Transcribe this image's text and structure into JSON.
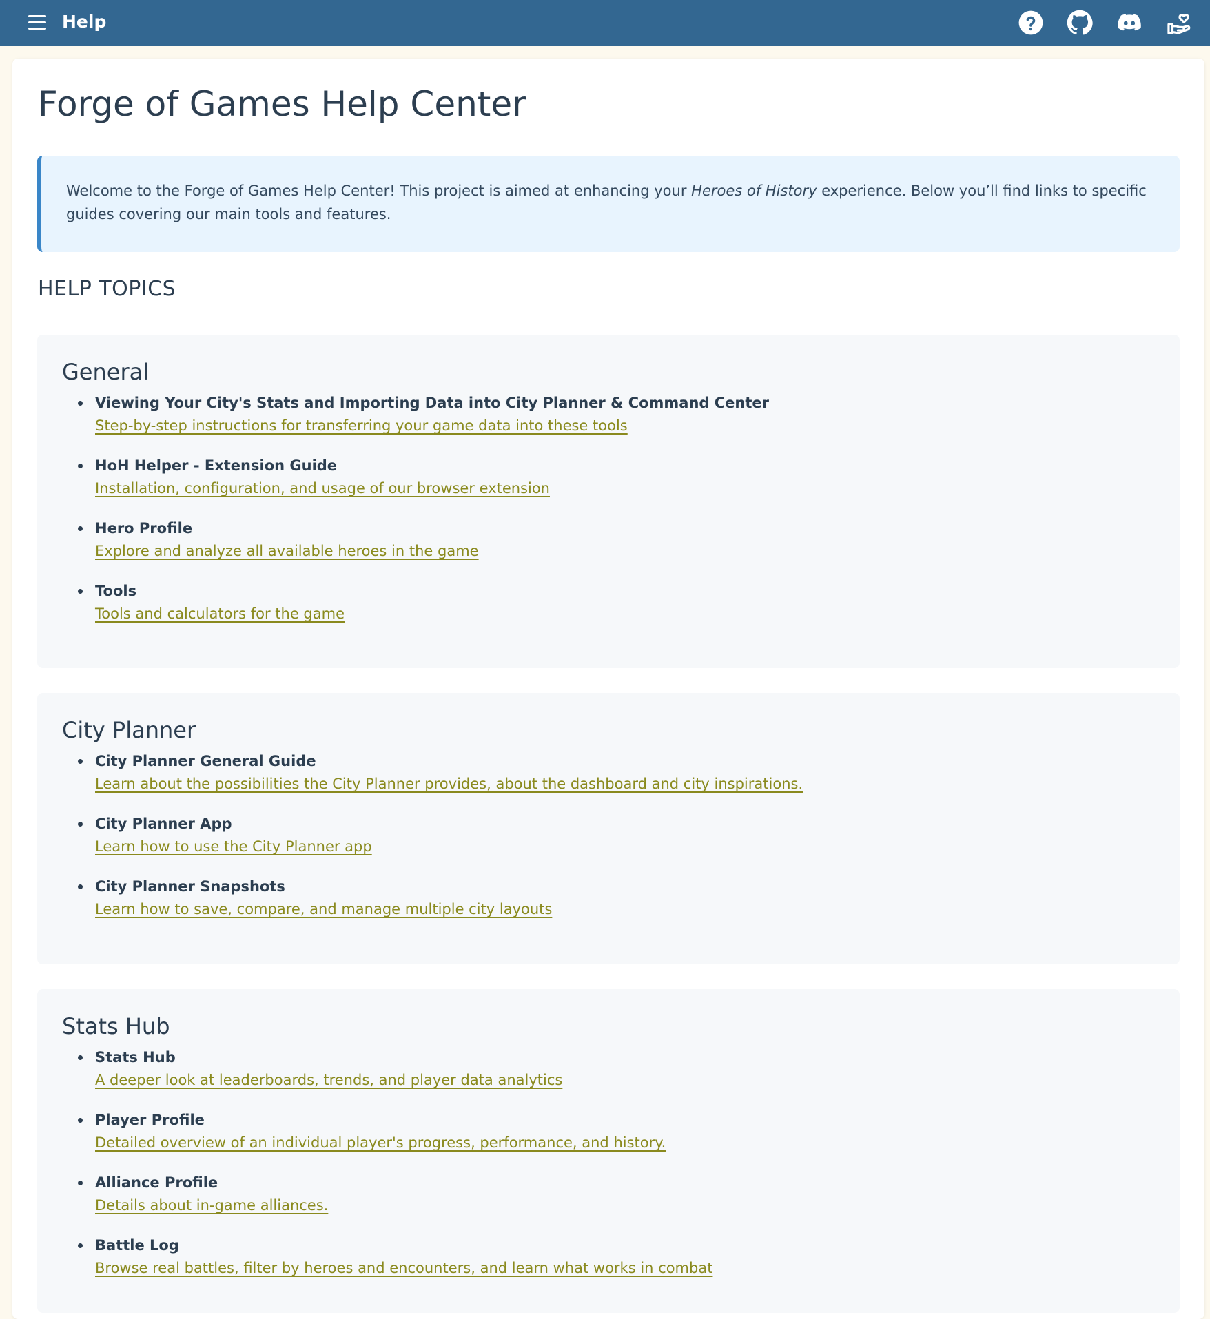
{
  "topbar": {
    "title": "Help",
    "icons": [
      "menu-icon",
      "help-circle-icon",
      "github-icon",
      "discord-icon",
      "support-hand-heart-icon"
    ],
    "background": "#336791"
  },
  "page": {
    "title": "Forge of Games Help Center",
    "intro_before": "Welcome to the Forge of Games Help Center! This project is aimed at enhancing your ",
    "intro_emphasis": "Heroes of History",
    "intro_after": " experience. Below you’ll find links to specific guides covering our main tools and features.",
    "topics_heading": "HELP TOPICS"
  },
  "colors": {
    "accent": "#3a86c8",
    "link": "#8a8a1e",
    "text": "#2c3e50",
    "intro_bg": "#e8f4fe",
    "section_bg": "#f6f8fa"
  },
  "sections": [
    {
      "title": "General",
      "items": [
        {
          "title": "Viewing Your City's Stats and Importing Data into City Planner & Command Center",
          "link": "Step-by-step instructions for transferring your game data into these tools"
        },
        {
          "title": "HoH Helper - Extension Guide",
          "link": "Installation, configuration, and usage of our browser extension"
        },
        {
          "title": "Hero Profile",
          "link": "Explore and analyze all available heroes in the game"
        },
        {
          "title": "Tools",
          "link": "Tools and calculators for the game"
        }
      ]
    },
    {
      "title": "City Planner",
      "items": [
        {
          "title": "City Planner General Guide",
          "link": "Learn about the possibilities the City Planner provides, about the dashboard and city inspirations."
        },
        {
          "title": "City Planner App",
          "link": "Learn how to use the City Planner app"
        },
        {
          "title": "City Planner Snapshots",
          "link": "Learn how to save, compare, and manage multiple city layouts"
        }
      ]
    },
    {
      "title": "Stats Hub",
      "items": [
        {
          "title": "Stats Hub",
          "link": "A deeper look at leaderboards, trends, and player data analytics"
        },
        {
          "title": "Player Profile",
          "link": "Detailed overview of an individual player's progress, performance, and history."
        },
        {
          "title": "Alliance Profile",
          "link": "Details about in-game alliances."
        },
        {
          "title": "Battle Log",
          "link": "Browse real battles, filter by heroes and encounters, and learn what works in combat"
        }
      ]
    }
  ]
}
